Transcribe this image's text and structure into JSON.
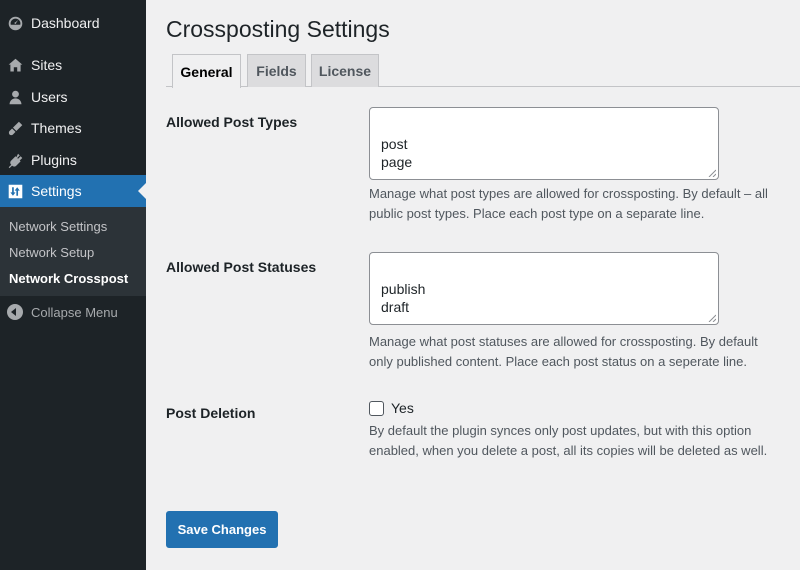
{
  "sidebar": {
    "items": [
      {
        "label": "Dashboard",
        "icon": "dashboard-icon"
      },
      {
        "label": "Sites",
        "icon": "sites-icon"
      },
      {
        "label": "Users",
        "icon": "users-icon"
      },
      {
        "label": "Themes",
        "icon": "themes-icon"
      },
      {
        "label": "Plugins",
        "icon": "plugins-icon"
      },
      {
        "label": "Settings",
        "icon": "settings-icon",
        "active": true
      }
    ],
    "submenu": [
      "Network Settings",
      "Network Setup",
      "Network Crosspost"
    ],
    "current_submenu": "Network Crosspost",
    "collapse_label": "Collapse Menu"
  },
  "page": {
    "title": "Crossposting Settings"
  },
  "tabs": [
    {
      "label": "General",
      "active": true
    },
    {
      "label": "Fields",
      "active": false
    },
    {
      "label": "License",
      "active": false
    }
  ],
  "fields": {
    "post_types": {
      "label": "Allowed Post Types",
      "value": "post\npage",
      "description": "Manage what post types are allowed for crossposting. By default – all public post types. Place each post type on a separate line."
    },
    "post_statuses": {
      "label": "Allowed Post Statuses",
      "value": "publish\ndraft",
      "description": "Manage what post statuses are allowed for crossposting. By default only published content. Place each post status on a seperate line."
    },
    "post_deletion": {
      "label": "Post Deletion",
      "checkbox_label": "Yes",
      "checked": false,
      "description": "By default the plugin synces only post updates, but with this option enabled, when you delete a post, all its copies will be deleted as well."
    }
  },
  "actions": {
    "save_label": "Save Changes"
  },
  "colors": {
    "sidebar_bg": "#1d2327",
    "accent": "#2271b1",
    "page_bg": "#f0f0f1"
  }
}
